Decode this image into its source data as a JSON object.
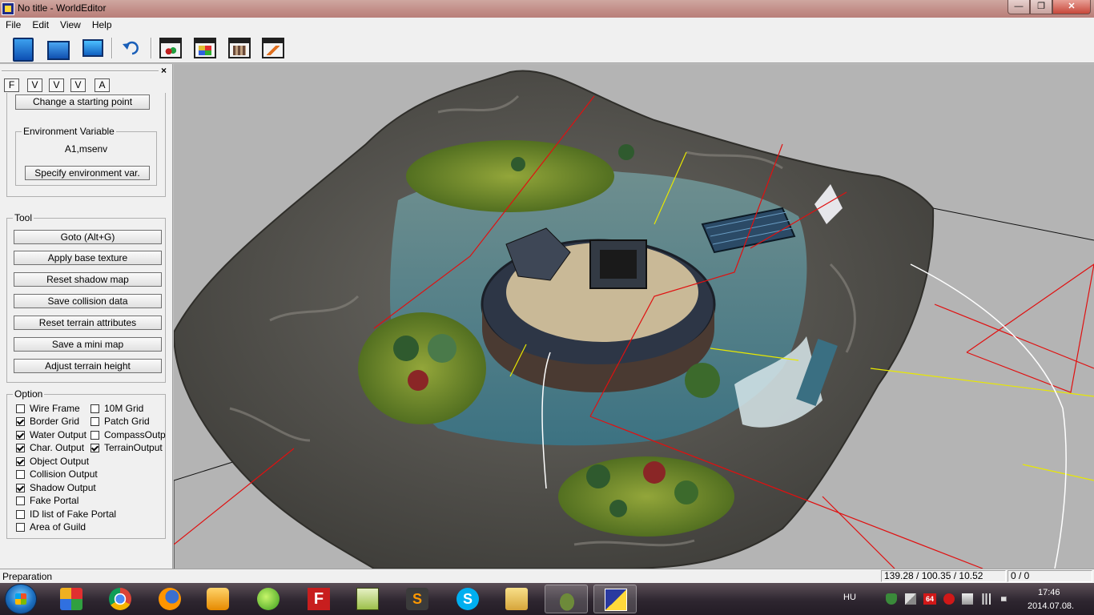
{
  "window": {
    "title": "No title - WorldEditor",
    "minimize": "—",
    "maximize": "❐",
    "close": "✕"
  },
  "menu": [
    "File",
    "Edit",
    "View",
    "Help"
  ],
  "toolbar": {
    "icons": [
      "new-document-icon",
      "open-folder-icon",
      "save-monitor-icon",
      "undo-icon",
      "object-window-icon",
      "texture-window-icon",
      "attribute-window-icon",
      "paint-window-icon"
    ]
  },
  "panel": {
    "close": "×",
    "tabs": [
      "F",
      "V",
      "V",
      "V",
      "A"
    ],
    "change_start_button": "Change a starting point",
    "environment": {
      "title": "Environment Variable",
      "value": "A1,msenv",
      "button": "Specify environment var."
    },
    "tool": {
      "title": "Tool",
      "buttons": [
        "Goto (Alt+G)",
        "Apply base texture",
        "Reset shadow map",
        "Save collision data",
        "Reset terrain attributes",
        "Save a mini map",
        "Adjust terrain height"
      ]
    },
    "option": {
      "title": "Option",
      "items": [
        {
          "label": "Wire Frame",
          "checked": false
        },
        {
          "label": "10M Grid",
          "checked": false
        },
        {
          "label": "Border Grid",
          "checked": true
        },
        {
          "label": "Patch Grid",
          "checked": false
        },
        {
          "label": "Water Output",
          "checked": true
        },
        {
          "label": "CompassOutput",
          "checked": false
        },
        {
          "label": "Char. Output",
          "checked": true
        },
        {
          "label": "TerrainOutput",
          "checked": true
        },
        {
          "label": "Object Output",
          "checked": true
        },
        {
          "label": "Collision Output",
          "checked": false
        },
        {
          "label": "Shadow Output",
          "checked": true
        },
        {
          "label": "Fake Portal",
          "checked": false
        },
        {
          "label": "ID list of Fake Portal",
          "checked": false
        },
        {
          "label": "Area of Guild",
          "checked": false
        }
      ]
    }
  },
  "status": {
    "left": "Preparation",
    "coords": "139.28 / 100.35 / 10.52",
    "count": "0 / 0"
  },
  "taskbar": {
    "apps": [
      "start-menu-grid-icon",
      "chrome-icon",
      "firefox-icon",
      "media-player-icon",
      "messenger-icon",
      "filezilla-icon",
      "notepad-icon",
      "sublime-icon",
      "skype-icon",
      "explorer-icon",
      "turtle-icon",
      "worldeditor-icon"
    ],
    "language": "HU",
    "badge": "64",
    "time": "17:46",
    "date": "2014.07.08."
  },
  "colors": {
    "titlebar": "#c18d87",
    "panel": "#f0f0f0",
    "viewport": "#b4b4b4",
    "water": "#4f7f8a",
    "grass": "#6d8a2e",
    "rock": "#5b5a55"
  }
}
